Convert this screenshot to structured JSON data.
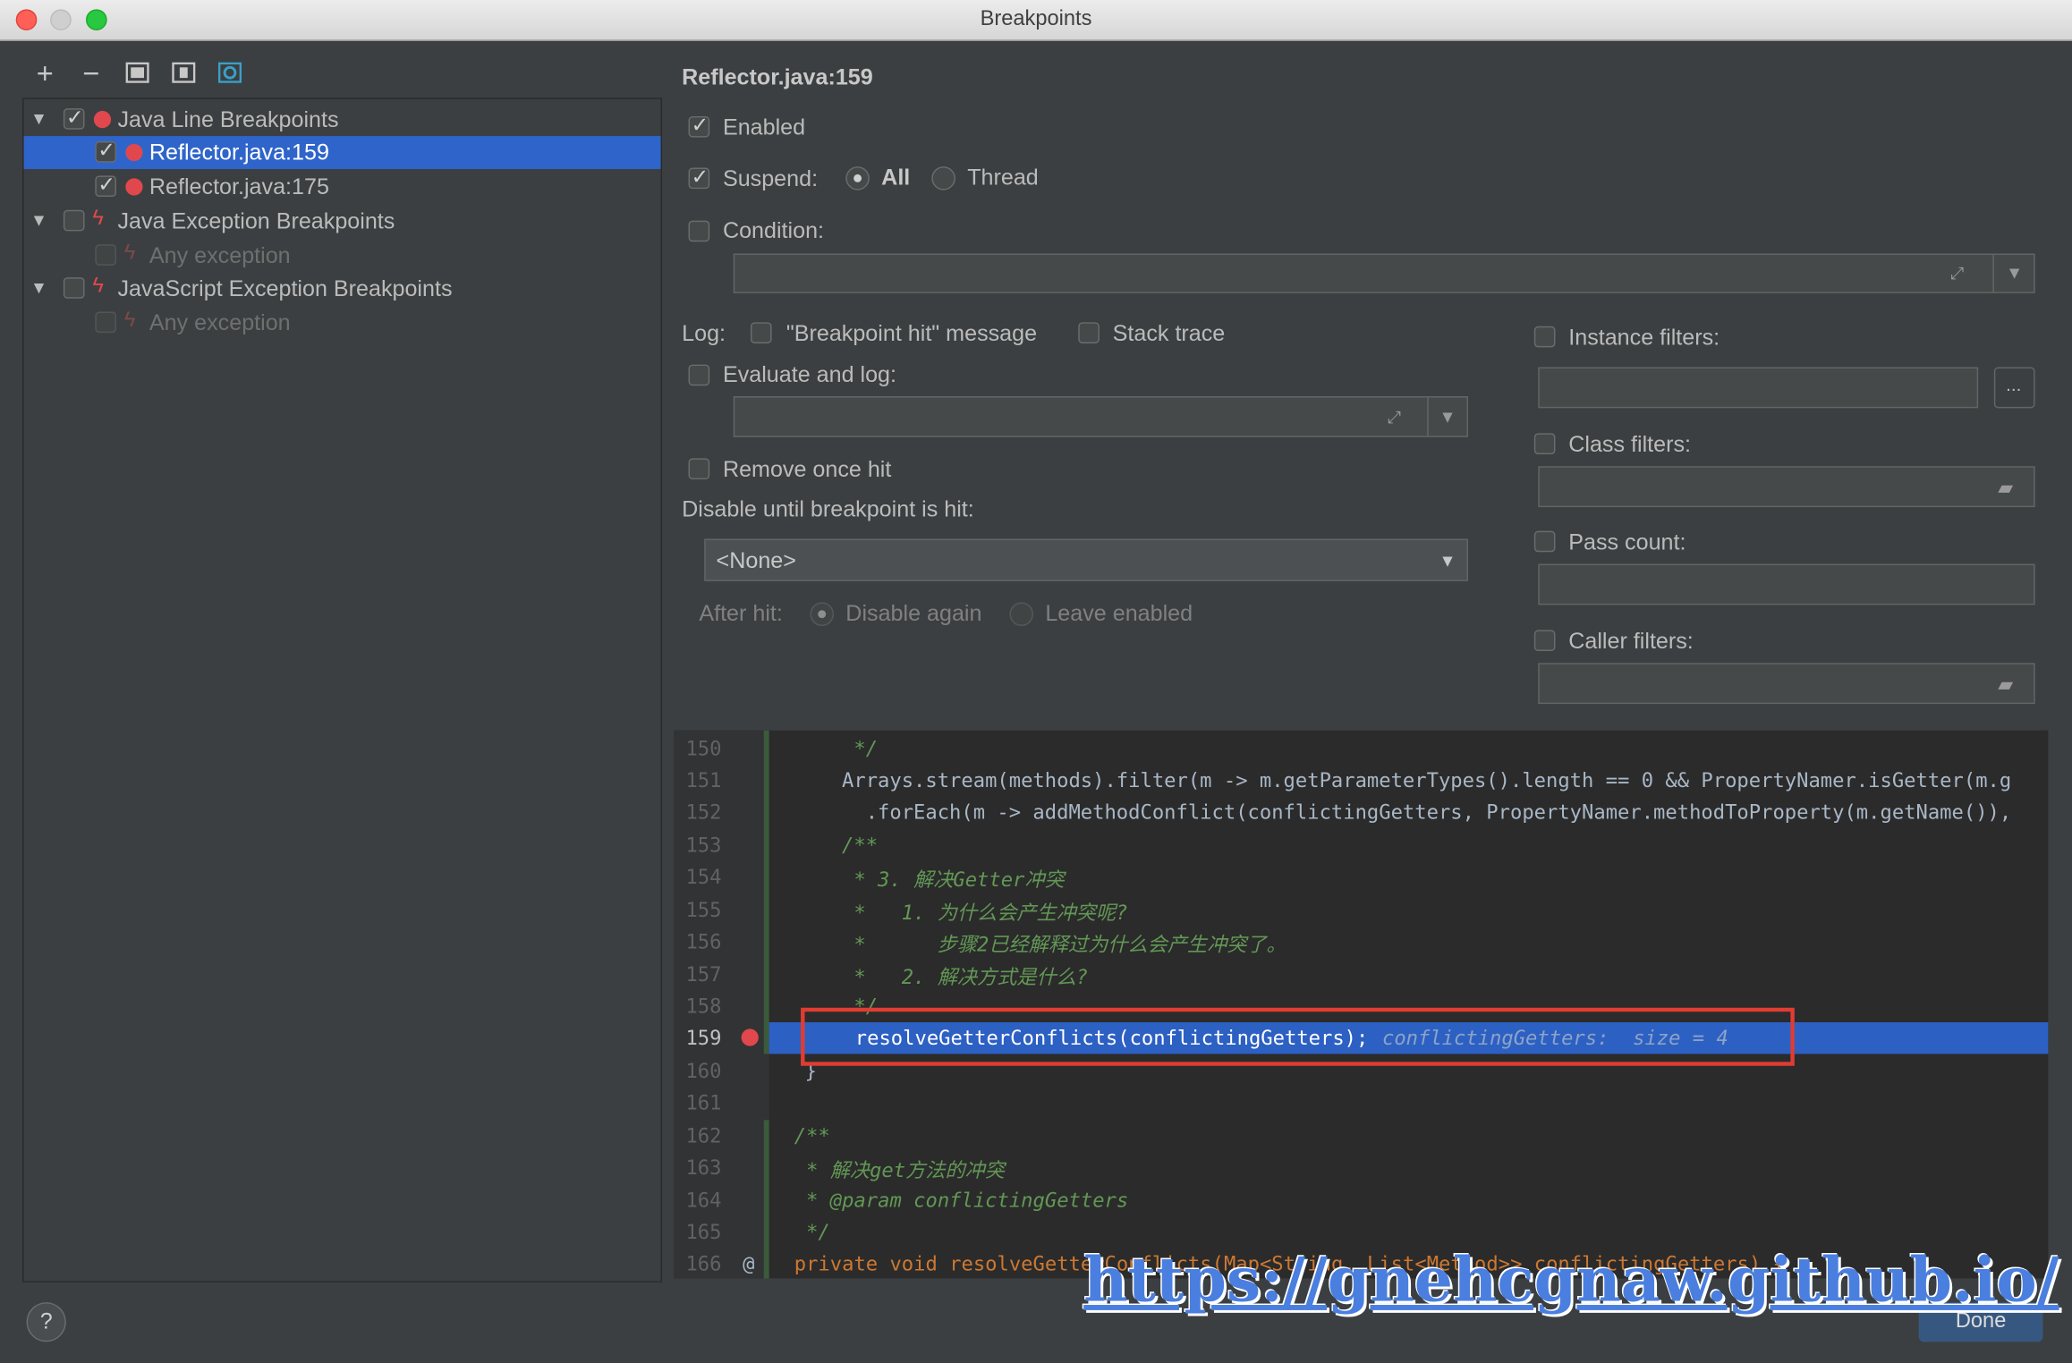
{
  "window": {
    "title": "Breakpoints"
  },
  "toolbar": {
    "add_icon": "plus-icon",
    "remove_icon": "minus-icon",
    "group_by_package_icon": "folder-icon",
    "group_by_file_icon": "file-group-icon",
    "group_by_class_icon": "class-icon"
  },
  "tree": {
    "groups": [
      {
        "label": "Java Line Breakpoints",
        "checked": true,
        "items": [
          {
            "label": "Reflector.java:159",
            "checked": true,
            "selected": true
          },
          {
            "label": "Reflector.java:175",
            "checked": true,
            "selected": false
          }
        ]
      },
      {
        "label": "Java Exception Breakpoints",
        "checked": false,
        "items": [
          {
            "label": "Any exception",
            "checked": false
          }
        ]
      },
      {
        "label": "JavaScript Exception Breakpoints",
        "checked": false,
        "items": [
          {
            "label": "Any exception",
            "checked": false
          }
        ]
      }
    ]
  },
  "details": {
    "heading": "Reflector.java:159",
    "enabled_label": "Enabled",
    "suspend_label": "Suspend:",
    "suspend_all": "All",
    "suspend_thread": "Thread",
    "condition_label": "Condition:",
    "log_label": "Log:",
    "log_message": "\"Breakpoint hit\" message",
    "log_stack": "Stack trace",
    "evaluate_label": "Evaluate and log:",
    "remove_once": "Remove once hit",
    "disable_until_label": "Disable until breakpoint is hit:",
    "disable_until_value": "<None>",
    "after_hit_label": "After hit:",
    "after_disable": "Disable again",
    "after_leave": "Leave enabled",
    "instance_filters": "Instance filters:",
    "instance_browse": "...",
    "class_filters": "Class filters:",
    "pass_count": "Pass count:",
    "caller_filters": "Caller filters:"
  },
  "code": {
    "lines": [
      {
        "n": "150",
        "t": "    */"
      },
      {
        "n": "151",
        "t": "   Arrays.stream(methods).filter(m -> m.getParameterTypes().length == 0 && PropertyNamer.isGetter(m.g"
      },
      {
        "n": "152",
        "t": "     .forEach(m -> addMethodConflict(conflictingGetters, PropertyNamer.methodToProperty(m.getName()),"
      },
      {
        "n": "153",
        "t": "   /**"
      },
      {
        "n": "154",
        "t": "    * 3. 解决Getter冲突"
      },
      {
        "n": "155",
        "t": "    *   1. 为什么会产生冲突呢?"
      },
      {
        "n": "156",
        "t": "    *      步骤2已经解释过为什么会产生冲突了。"
      },
      {
        "n": "157",
        "t": "    *   2. 解决方式是什么?"
      },
      {
        "n": "158",
        "t": "    */"
      },
      {
        "n": "159",
        "t": "   resolveGetterConflicts(conflictingGetters);"
      },
      {
        "n": "160",
        "t": " }"
      },
      {
        "n": "161",
        "t": ""
      },
      {
        "n": "162",
        "t": " /**"
      },
      {
        "n": "163",
        "t": "  * 解决get方法的冲突"
      },
      {
        "n": "164",
        "t": "  * @param conflictingGetters"
      },
      {
        "n": "165",
        "t": "  */"
      },
      {
        "n": "166",
        "t": " private void resolveGetterConflicts(Map<String, List<Method>> conflictingGetters) {"
      }
    ],
    "inline_hint": "conflictingGetters:  size = 4",
    "current_line": "159"
  },
  "footer": {
    "help_label": "?",
    "done_label": "Done",
    "watermark": "https://gnehcgnaw.github.io/"
  },
  "colors": {
    "selection": "#2f65ca",
    "breakpoint_red": "#e0484e",
    "highlight_box": "#e03c33",
    "execution_line": "#2d60c3"
  }
}
